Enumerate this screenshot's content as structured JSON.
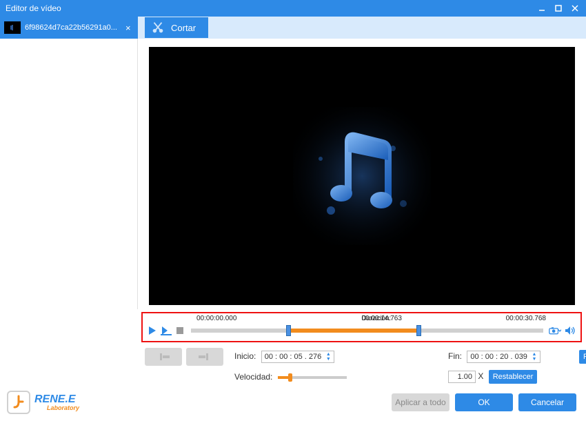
{
  "window": {
    "title": "Editor de vídeo"
  },
  "sidebar": {
    "file_name": "6f98624d7ca22b56291a0...",
    "close_glyph": "×"
  },
  "tabs": {
    "cut": {
      "label": "Cortar"
    }
  },
  "timeline": {
    "start_time": "00:00:00.000",
    "duration_label": "Duración:",
    "duration_value": "00:00:14.763",
    "end_time": "00:00:30.768"
  },
  "controls": {
    "inicio_label": "Inicio:",
    "inicio_value": "00 : 00 : 05 . 276",
    "fin_label": "Fin:",
    "fin_value": "00 : 00 : 20 . 039",
    "reset_label": "Restablecer",
    "velocidad_label": "Velocidad:",
    "speed_value": "1.00",
    "speed_unit": "X",
    "speed_reset_label": "Restablecer"
  },
  "footer": {
    "brand_main": "RENE.E",
    "brand_sub": "Laboratory",
    "apply_all_label": "Aplicar a todo",
    "ok_label": "OK",
    "cancel_label": "Cancelar"
  },
  "colors": {
    "accent": "#2e8ae6",
    "selection": "#f28c1e",
    "highlight_border": "#e11"
  }
}
